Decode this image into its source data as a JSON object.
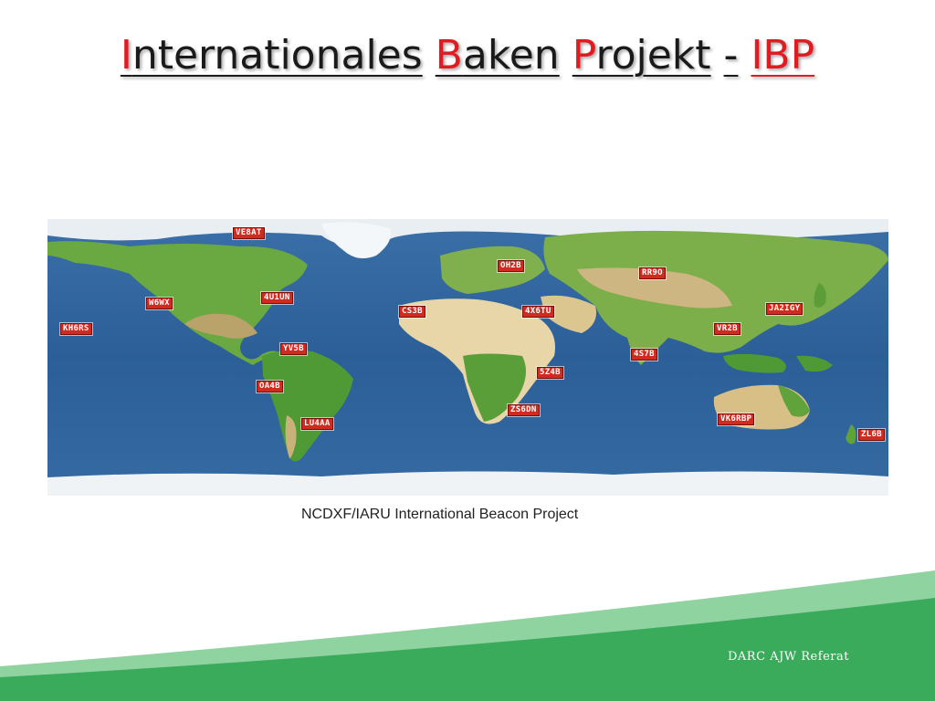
{
  "title": {
    "words": [
      {
        "cap": "I",
        "rest": "nternationales"
      },
      {
        "cap": "B",
        "rest": "aken"
      },
      {
        "cap": "P",
        "rest": "rojekt"
      }
    ],
    "separator": "-",
    "abbr": "IBP"
  },
  "map": {
    "caption": "NCDXF/IARU International Beacon Project",
    "beacons": [
      {
        "id": "ve8at",
        "label": "VE8AT"
      },
      {
        "id": "w6wx",
        "label": "W6WX"
      },
      {
        "id": "kh6rs",
        "label": "KH6RS"
      },
      {
        "id": "4u1un",
        "label": "4U1UN"
      },
      {
        "id": "yv5b",
        "label": "YV5B"
      },
      {
        "id": "oa4b",
        "label": "OA4B"
      },
      {
        "id": "lu4aa",
        "label": "LU4AA"
      },
      {
        "id": "cs3b",
        "label": "CS3B"
      },
      {
        "id": "oh2b",
        "label": "OH2B"
      },
      {
        "id": "4x6tu",
        "label": "4X6TU"
      },
      {
        "id": "5z4b",
        "label": "5Z4B"
      },
      {
        "id": "zs6dn",
        "label": "ZS6DN"
      },
      {
        "id": "rr9o",
        "label": "RR9O"
      },
      {
        "id": "4s7b",
        "label": "4S7B"
      },
      {
        "id": "vr2b",
        "label": "VR2B"
      },
      {
        "id": "ja2igy",
        "label": "JA2IGY"
      },
      {
        "id": "vk6rbp",
        "label": "VK6RBP"
      },
      {
        "id": "zl6b",
        "label": "ZL6B"
      }
    ]
  },
  "footer": {
    "text": "DARC AJW Referat"
  },
  "colors": {
    "accent_red": "#e01b22",
    "beacon_red": "#d12a1f",
    "ocean": "#2f5f9a",
    "land_green": "#5fa33a",
    "footer_green": "#3aaa5b",
    "footer_light_green": "#8fd3a0"
  }
}
